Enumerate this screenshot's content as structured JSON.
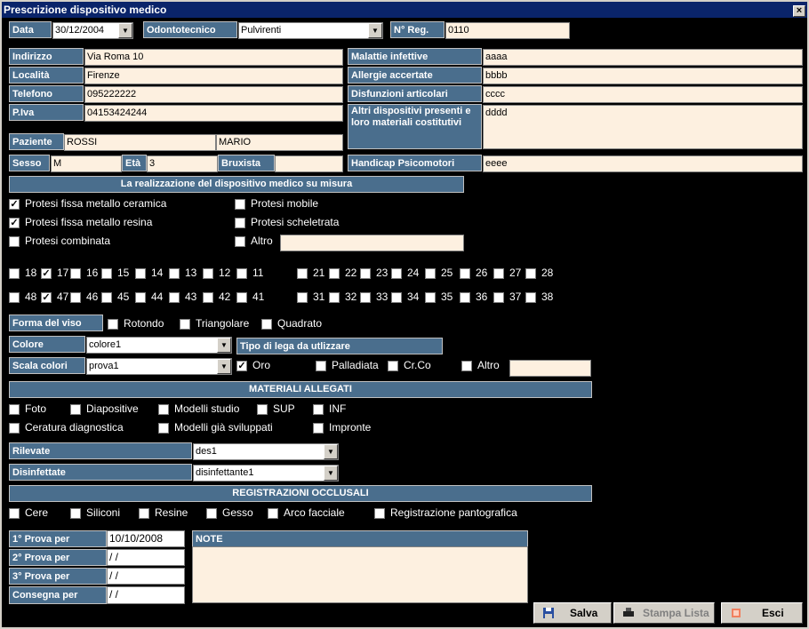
{
  "window": {
    "title": "Prescrizione dispositivo medico",
    "close": "×"
  },
  "labels": {
    "data": "Data",
    "odontotecnico": "Odontotecnico",
    "nreg": "N° Reg.",
    "indirizzo": "Indirizzo",
    "localita": "Località",
    "telefono": "Telefono",
    "piva": "P.Iva",
    "paziente": "Paziente",
    "sesso": "Sesso",
    "eta": "Età",
    "bruxista": "Bruxista",
    "malattie": "Malattie infettive",
    "allergie": "Allergie accertate",
    "disfunzioni": "Disfunzioni articolari",
    "altri": "Altri dispositivi presenti e loro materiali costitutivi",
    "handicap": "Handicap Psicomotori",
    "forma": "Forma del viso",
    "colore": "Colore",
    "scala": "Scala colori",
    "tipo_lega": "Tipo di lega da utlizzare",
    "rilevate": "Rilevate",
    "disinfettate": "Disinfettate",
    "prova1": "1° Prova per",
    "prova2": "2° Prova per",
    "prova3": "3° Prova per",
    "consegna": "Consegna per",
    "note": "NOTE"
  },
  "values": {
    "data": "30/12/2004",
    "odontotecnico": "Pulvirenti",
    "nreg": "0110",
    "indirizzo": "Via Roma 10",
    "localita": "Firenze",
    "telefono": "095222222",
    "piva": "04153424244",
    "cognome": "ROSSI",
    "nome": "MARIO",
    "sesso": "M",
    "eta": "3",
    "bruxista": "",
    "malattie": "aaaa",
    "allergie": "bbbb",
    "disfunzioni": "cccc",
    "altri": "dddd",
    "handicap": "eeee",
    "colore": "colore1",
    "scala": "prova1",
    "rilevate": "des1",
    "disinfettate": "disinfettante1",
    "prova1": "10/10/2008",
    "prova2": " / /",
    "prova3": " / /",
    "consegna": " / /",
    "altro_text": "",
    "altro_lega": ""
  },
  "headers": {
    "realizzazione": "La realizzazione del dispositivo medico su misura",
    "materiali": "MATERIALI ALLEGATI",
    "registrazioni": "REGISTRAZIONI OCCLUSALI"
  },
  "protesi": [
    {
      "label": "Protesi fissa metallo ceramica",
      "checked": true
    },
    {
      "label": "Protesi fissa metallo resina",
      "checked": true
    },
    {
      "label": "Protesi combinata",
      "checked": false
    },
    {
      "label": "Protesi mobile",
      "checked": false
    },
    {
      "label": "Protesi scheletrata",
      "checked": false
    },
    {
      "label": "Altro",
      "checked": false
    }
  ],
  "teeth_row1": [
    {
      "n": "18",
      "c": false
    },
    {
      "n": "17",
      "c": true
    },
    {
      "n": "16",
      "c": false
    },
    {
      "n": "15",
      "c": false
    },
    {
      "n": "14",
      "c": false
    },
    {
      "n": "13",
      "c": false
    },
    {
      "n": "12",
      "c": false
    },
    {
      "n": "11",
      "c": false
    },
    {
      "n": "21",
      "c": false
    },
    {
      "n": "22",
      "c": false
    },
    {
      "n": "23",
      "c": false
    },
    {
      "n": "24",
      "c": false
    },
    {
      "n": "25",
      "c": false
    },
    {
      "n": "26",
      "c": false
    },
    {
      "n": "27",
      "c": false
    },
    {
      "n": "28",
      "c": false
    }
  ],
  "teeth_row2": [
    {
      "n": "48",
      "c": false
    },
    {
      "n": "47",
      "c": true
    },
    {
      "n": "46",
      "c": false
    },
    {
      "n": "45",
      "c": false
    },
    {
      "n": "44",
      "c": false
    },
    {
      "n": "43",
      "c": false
    },
    {
      "n": "42",
      "c": false
    },
    {
      "n": "41",
      "c": false
    },
    {
      "n": "31",
      "c": false
    },
    {
      "n": "32",
      "c": false
    },
    {
      "n": "33",
      "c": false
    },
    {
      "n": "34",
      "c": false
    },
    {
      "n": "35",
      "c": false
    },
    {
      "n": "36",
      "c": false
    },
    {
      "n": "37",
      "c": false
    },
    {
      "n": "38",
      "c": false
    }
  ],
  "forma": [
    {
      "label": "Rotondo",
      "checked": false
    },
    {
      "label": "Triangolare",
      "checked": false
    },
    {
      "label": "Quadrato",
      "checked": false
    }
  ],
  "lega": [
    {
      "label": "Oro",
      "checked": true
    },
    {
      "label": "Palladiata",
      "checked": false
    },
    {
      "label": "Cr.Co",
      "checked": false
    },
    {
      "label": "Altro",
      "checked": false
    }
  ],
  "materiali": [
    {
      "label": "Foto",
      "checked": false
    },
    {
      "label": "Diapositive",
      "checked": false
    },
    {
      "label": "Modelli studio",
      "checked": false
    },
    {
      "label": "SUP",
      "checked": false
    },
    {
      "label": "INF",
      "checked": false
    },
    {
      "label": "Ceratura diagnostica",
      "checked": false
    },
    {
      "label": "Modelli già sviluppati",
      "checked": false
    },
    {
      "label": "Impronte",
      "checked": false
    }
  ],
  "registrazioni": [
    {
      "label": "Cere",
      "checked": false
    },
    {
      "label": "Siliconi",
      "checked": false
    },
    {
      "label": "Resine",
      "checked": false
    },
    {
      "label": "Gesso",
      "checked": false
    },
    {
      "label": "Arco facciale",
      "checked": false
    },
    {
      "label": "Registrazione pantografica",
      "checked": false
    }
  ],
  "buttons": {
    "salva": "Salva",
    "stampa": "Stampa Lista",
    "esci": "Esci"
  },
  "colors": {
    "label_bg": "#4a6e8d",
    "field_bg": "#fdf0e0",
    "title_bg": "#0a246a"
  }
}
